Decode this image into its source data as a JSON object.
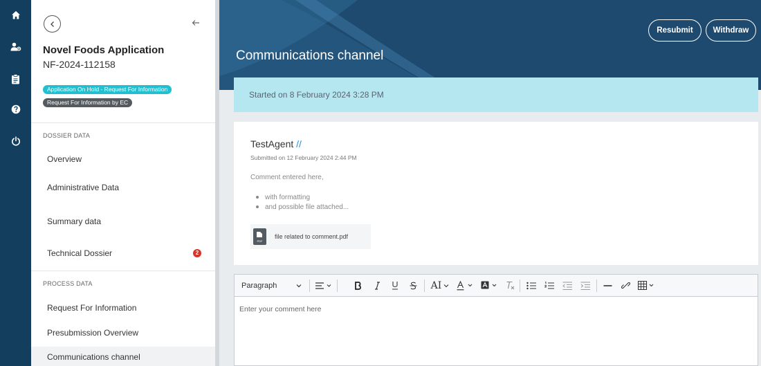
{
  "sidebar": {
    "application_title": "Novel Foods Application",
    "application_id": "NF-2024-112158",
    "status_badges": [
      "Application On Hold - Request For Information",
      "Request For Information by EC"
    ],
    "sections": {
      "dossier": {
        "label": "DOSSIER DATA",
        "items": [
          "Overview",
          "Administrative Data",
          "Summary data",
          "Technical Dossier"
        ],
        "technical_dossier_count": "2"
      },
      "process": {
        "label": "PROCESS DATA",
        "items": [
          "Request For Information",
          "Presubmission Overview",
          "Communications channel"
        ]
      }
    }
  },
  "header": {
    "title": "Communications channel",
    "resubmit_label": "Resubmit",
    "withdraw_label": "Withdraw"
  },
  "banner": {
    "started_text": "Started on 8 February 2024 3:28 PM"
  },
  "comment": {
    "author": "TestAgent",
    "author_suffix": "//",
    "submitted": "Submitted on 12 February 2024 2:44 PM",
    "text": "Comment entered here,",
    "bullets": [
      "with formatting",
      "and possible file attached..."
    ],
    "attachment_name": "file related to comment.pdf",
    "attachment_icon_label": "PDF"
  },
  "editor": {
    "paragraph_label": "Paragraph",
    "placeholder": "Enter your comment here",
    "font_size_label": "AI"
  },
  "colors": {
    "rail": "#133e5e",
    "header": "#1d4a6e",
    "banner": "#b5e7f1",
    "badge_hold": "#22bfd0",
    "badge_rfi": "#555a5f",
    "notification": "#d9342b",
    "author_accent": "#2a8ed6"
  },
  "icons": {
    "rail": [
      "home-icon",
      "user-group-icon",
      "clipboard-icon",
      "help-icon",
      "power-icon"
    ]
  }
}
